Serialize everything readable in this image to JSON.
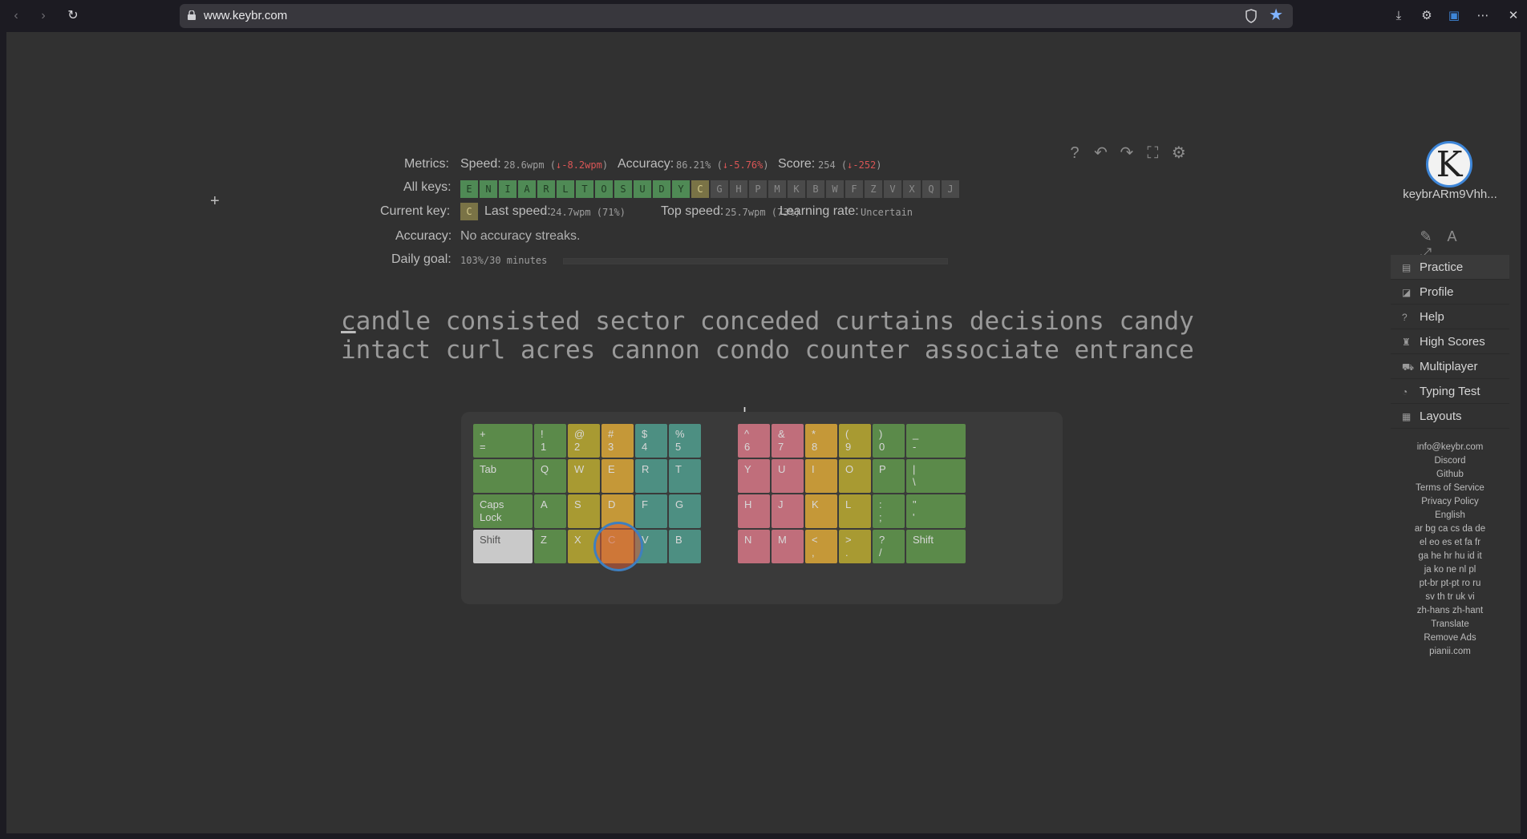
{
  "browser": {
    "url": "www.keybr.com"
  },
  "metrics": {
    "metrics_label": "Metrics:",
    "speed_label": "Speed:",
    "speed_value": "28.6wpm",
    "speed_delta": "↓-8.2wpm",
    "accuracy_label": "Accuracy:",
    "accuracy_value": "86.21%",
    "accuracy_delta": "↓-5.76%",
    "score_label": "Score:",
    "score_value": "254",
    "score_delta": "↓-252",
    "all_keys_label": "All keys:",
    "keys_done": [
      "E",
      "N",
      "I",
      "A",
      "R",
      "L",
      "T",
      "O",
      "S",
      "U",
      "D",
      "Y"
    ],
    "key_current": "C",
    "keys_todo": [
      "G",
      "H",
      "P",
      "M",
      "K",
      "B",
      "W",
      "F",
      "Z",
      "V",
      "X",
      "Q",
      "J"
    ],
    "current_key_label": "Current key:",
    "current_key": "C",
    "last_speed_label": "Last speed:",
    "last_speed_value": "24.7wpm (71%)",
    "top_speed_label": "Top speed:",
    "top_speed_value": "25.7wpm (73%)",
    "learning_rate_label": "Learning rate:",
    "learning_rate_value": "Uncertain",
    "accuracy_row_label": "Accuracy:",
    "accuracy_row_value": "No accuracy streaks.",
    "daily_goal_label": "Daily goal:",
    "daily_goal_value": "103%/30 minutes",
    "daily_goal_progress": 1.0
  },
  "lesson": {
    "line1_first": "c",
    "line1_rest": "andle consisted sector conceded curtains decisions candy",
    "line2": "intact curl acres cannon condo counter associate entrance"
  },
  "keyboard": {
    "row1": [
      {
        "top": "+",
        "bottom": "=",
        "color": "g"
      },
      {
        "top": "!",
        "bottom": "1",
        "color": "g"
      },
      {
        "top": "@",
        "bottom": "2",
        "color": "y"
      },
      {
        "top": "#",
        "bottom": "3",
        "color": "o"
      },
      {
        "top": "$",
        "bottom": "4",
        "color": "t"
      },
      {
        "top": "%",
        "bottom": "5",
        "color": "t"
      },
      {
        "top": "^",
        "bottom": "6",
        "color": "p"
      },
      {
        "top": "&",
        "bottom": "7",
        "color": "p"
      },
      {
        "top": "*",
        "bottom": "8",
        "color": "o"
      },
      {
        "top": "(",
        "bottom": "9",
        "color": "y"
      },
      {
        "top": ")",
        "bottom": "0",
        "color": "g"
      },
      {
        "top": "_",
        "bottom": "-",
        "color": "g"
      }
    ],
    "tab": "Tab",
    "row2": [
      "Q",
      "W",
      "E",
      "R",
      "T",
      "Y",
      "U",
      "I",
      "O",
      "P"
    ],
    "row2_last_top": "|",
    "row2_last_bottom": "\\",
    "caps": "Caps Lock",
    "row3": [
      "A",
      "S",
      "D",
      "F",
      "G",
      "H",
      "J",
      "K",
      "L"
    ],
    "row3_semi_top": ":",
    "row3_semi_bottom": ";",
    "row3_quote_top": "\"",
    "row3_quote_bottom": "'",
    "shift_left": "Shift",
    "row4": [
      "Z",
      "X",
      "C",
      "V",
      "B",
      "N",
      "M"
    ],
    "row4_lt_top": "<",
    "row4_lt_bottom": ",",
    "row4_gt_top": ">",
    "row4_gt_bottom": ".",
    "row4_q_top": "?",
    "row4_q_bottom": "/",
    "shift_right": "Shift"
  },
  "sidebar": {
    "avatar_letter": "K",
    "username": "keybrARm9Vhh...",
    "menu": [
      {
        "icon": "▤",
        "label": "Practice"
      },
      {
        "icon": "◪",
        "label": "Profile"
      },
      {
        "icon": "?",
        "label": "Help"
      },
      {
        "icon": "♜",
        "label": "High Scores"
      },
      {
        "icon": "⛟",
        "label": "Multiplayer"
      },
      {
        "icon": "◔",
        "label": "Typing Test"
      },
      {
        "icon": "▦",
        "label": "Layouts"
      }
    ],
    "footer": [
      "info@keybr.com",
      "Discord",
      "Github",
      "Terms of Service",
      "Privacy Policy",
      "English",
      "ar bg ca cs da de",
      "el eo es et fa fr",
      "ga he hr hu id it",
      "ja ko ne nl pl",
      "pt-br pt-pt ro ru",
      "sv th tr uk vi",
      "zh-hans zh-hant",
      "Translate",
      "Remove Ads",
      "pianii.com"
    ]
  }
}
